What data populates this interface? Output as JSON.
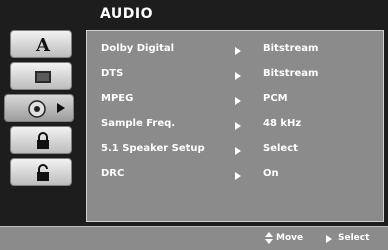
{
  "header": {
    "title": "AUDIO"
  },
  "sidebar": {
    "tabs": [
      {
        "icon": "letter-a-icon"
      },
      {
        "icon": "monitor-icon"
      },
      {
        "icon": "speaker-icon",
        "active": true
      },
      {
        "icon": "padlock-icon"
      },
      {
        "icon": "padlock-closed-icon"
      }
    ]
  },
  "menu": {
    "rows": [
      {
        "label": "Dolby Digital",
        "value": "Bitstream"
      },
      {
        "label": "DTS",
        "value": "Bitstream"
      },
      {
        "label": "MPEG",
        "value": "PCM"
      },
      {
        "label": "Sample Freq.",
        "value": "48 kHz"
      },
      {
        "label": "5.1 Speaker Setup",
        "value": "Select"
      },
      {
        "label": "DRC",
        "value": "On"
      }
    ]
  },
  "footer": {
    "move_label": "Move",
    "select_label": "Select"
  },
  "colors": {
    "screen_bg": "#1d1d1d",
    "panel_bg": "#8b8b8b",
    "text": "#ffffff"
  }
}
